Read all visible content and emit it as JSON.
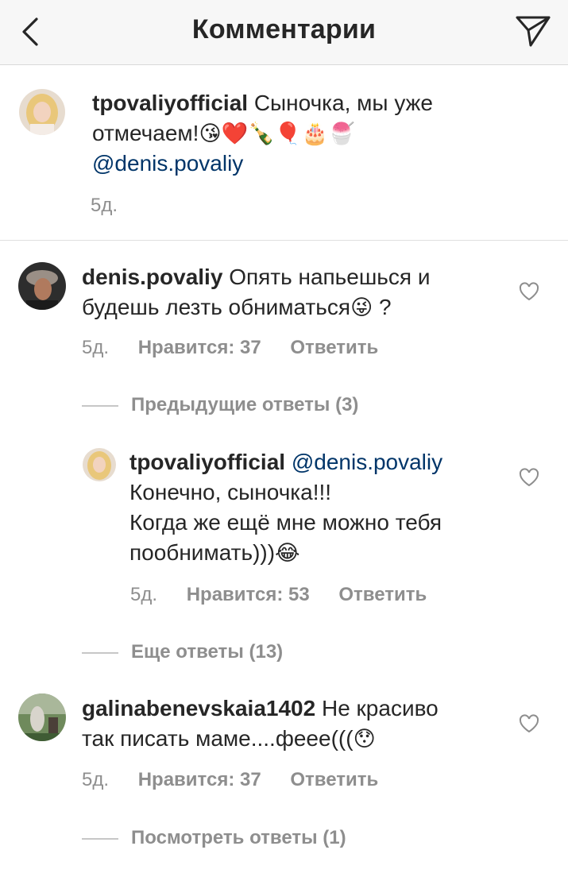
{
  "header": {
    "title": "Комментарии"
  },
  "caption": {
    "username": "tpovaliyofficial",
    "line1": "Сыночка, мы уже",
    "line2": "отмечаем!",
    "emojis": "😘❤️🍾🎈🎂🍧",
    "mention": "@denis.povaliy",
    "time": "5д."
  },
  "comments": [
    {
      "username": "denis.povaliy",
      "line1": "Опять напьешься и",
      "line2": "будешь лезть обниматься",
      "emoji": "😜",
      "after": " ?",
      "time": "5д.",
      "likes": "Нравится: 37",
      "reply": "Ответить"
    },
    {
      "username": "galinabenevskaia1402",
      "line1": "Не красиво",
      "line2": "так писать маме....феее(((",
      "emoji": "😯",
      "time": "5д.",
      "likes": "Нравится: 37",
      "reply": "Ответить"
    }
  ],
  "threads": {
    "previous": "Предыдущие ответы (3)",
    "more": "Еще ответы (13)",
    "view": "Посмотреть ответы (1)"
  },
  "reply": {
    "username": "tpovaliyofficial",
    "mention": "@denis.povaliy",
    "line1": "Конечно, сыночка!!!",
    "line2": "Когда же ещё мне можно тебя",
    "line3": "пообнимать)))",
    "emoji": "😂",
    "time": "5д.",
    "likes": "Нравится: 53",
    "reply_label": "Ответить"
  },
  "colors": {
    "text": "#262626",
    "secondary": "#8e8e8e",
    "mention": "#003569",
    "header_bg": "#f7f7f7"
  },
  "icons": [
    "chevron-left-icon",
    "send-icon",
    "heart-icon"
  ]
}
